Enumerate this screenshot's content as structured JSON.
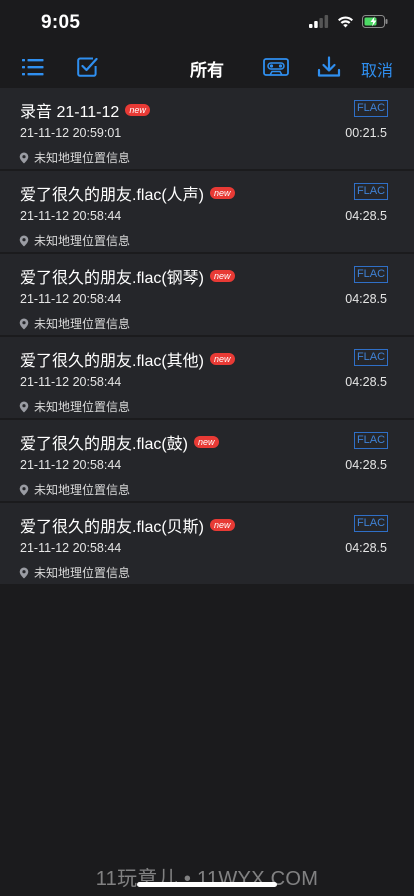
{
  "status_bar": {
    "time": "9:05",
    "battery_color": "#4cd964"
  },
  "toolbar": {
    "title": "所有",
    "cancel_label": "取消",
    "accent_color": "#2f8ff0",
    "icons": [
      "list-icon",
      "checkbox-icon",
      "cassette-icon",
      "download-icon"
    ]
  },
  "recordings": [
    {
      "title": "录音 21-11-12",
      "badge": "new",
      "format": "FLAC",
      "date": "21-11-12 20:59:01",
      "duration": "00:21.5",
      "location": "未知地理位置信息"
    },
    {
      "title": "爱了很久的朋友.flac(人声)",
      "badge": "new",
      "format": "FLAC",
      "date": "21-11-12 20:58:44",
      "duration": "04:28.5",
      "location": "未知地理位置信息"
    },
    {
      "title": "爱了很久的朋友.flac(钢琴)",
      "badge": "new",
      "format": "FLAC",
      "date": "21-11-12 20:58:44",
      "duration": "04:28.5",
      "location": "未知地理位置信息"
    },
    {
      "title": "爱了很久的朋友.flac(其他)",
      "badge": "new",
      "format": "FLAC",
      "date": "21-11-12 20:58:44",
      "duration": "04:28.5",
      "location": "未知地理位置信息"
    },
    {
      "title": "爱了很久的朋友.flac(鼓)",
      "badge": "new",
      "format": "FLAC",
      "date": "21-11-12 20:58:44",
      "duration": "04:28.5",
      "location": "未知地理位置信息"
    },
    {
      "title": "爱了很久的朋友.flac(贝斯)",
      "badge": "new",
      "format": "FLAC",
      "date": "21-11-12 20:58:44",
      "duration": "04:28.5",
      "location": "未知地理位置信息"
    }
  ],
  "watermark": "11玩意儿 • 11WYX.COM"
}
